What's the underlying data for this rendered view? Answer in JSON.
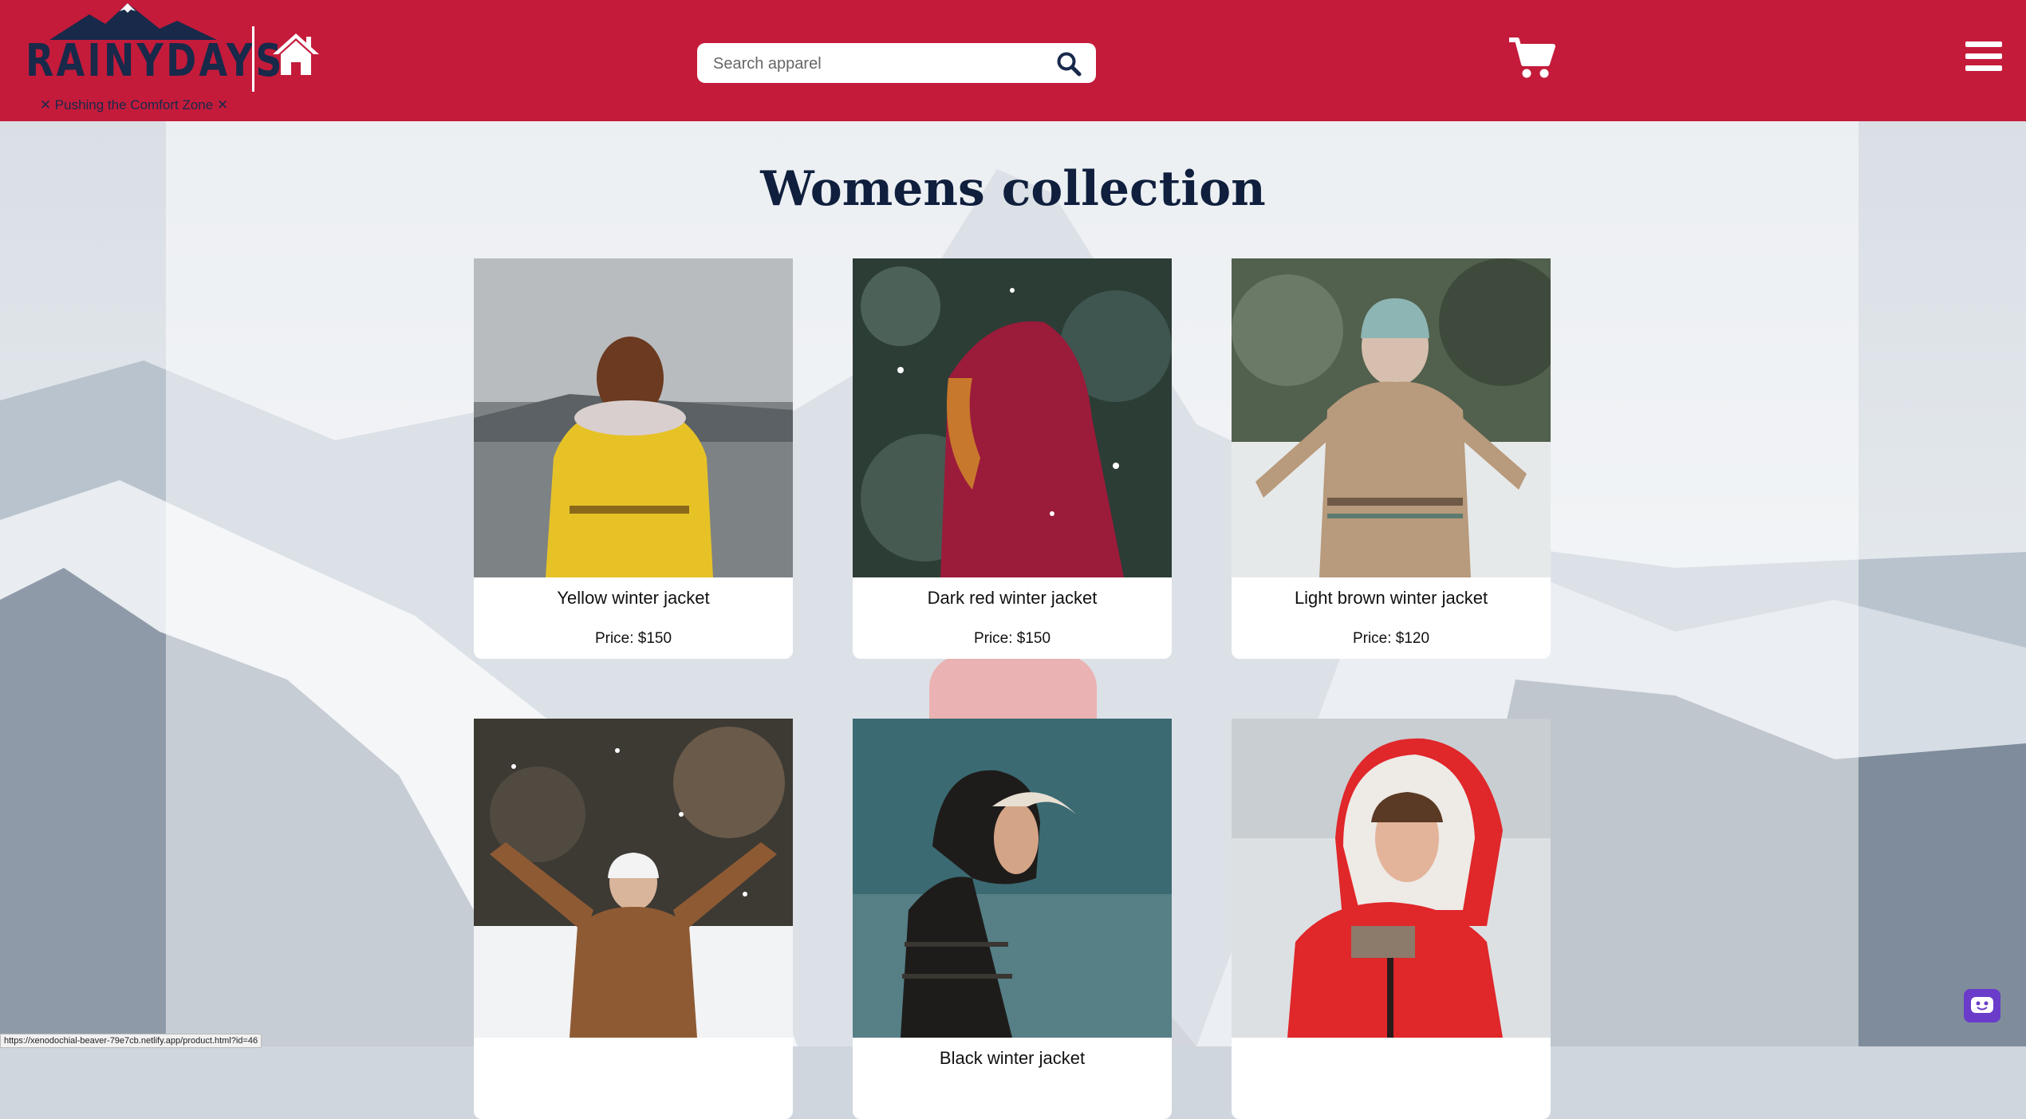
{
  "header": {
    "brand": "RAINYDAYS",
    "tagline": "✕ Pushing the Comfort Zone ✕",
    "search_placeholder": "Search apparel",
    "icons": {
      "home": "home-icon",
      "search": "search-icon",
      "cart": "cart-icon",
      "menu": "hamburger-menu-icon"
    }
  },
  "main": {
    "title": "Womens collection",
    "products": [
      {
        "name": "Yellow winter jacket",
        "price": "Price: $150",
        "jacket_color": "#e6c227"
      },
      {
        "name": "Dark red winter jacket",
        "price": "Price: $150",
        "jacket_color": "#9b1b3a"
      },
      {
        "name": "Light brown winter jacket",
        "price": "Price: $120",
        "jacket_color": "#b89a7c"
      },
      {
        "name": "",
        "price": "",
        "jacket_color": "#8e5a34"
      },
      {
        "name": "Black winter jacket",
        "price": "",
        "jacket_color": "#1e1c1a"
      },
      {
        "name": "",
        "price": "",
        "jacket_color": "#e0272a"
      }
    ]
  },
  "status_bar": {
    "url": "https://xenodochial-beaver-79e7cb.netlify.app/product.html?id=46"
  },
  "colors": {
    "header_bg": "#c41b3b",
    "brand_navy": "#18294a",
    "title": "#0f1f3d",
    "chat": "#6a3cc9"
  }
}
